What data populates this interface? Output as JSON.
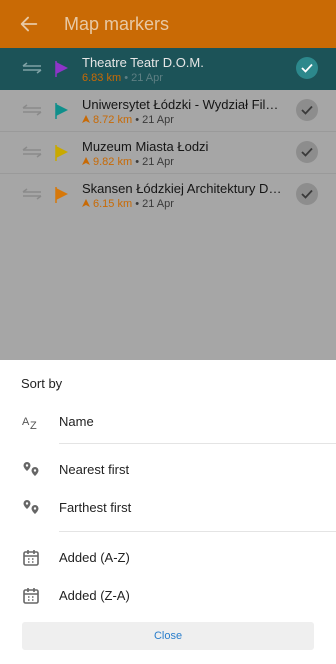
{
  "appbar": {
    "title": "Map markers",
    "back_icon": "arrow-left-icon"
  },
  "markers": [
    {
      "name": "Theatre Teatr D.O.M.",
      "distance": "6.83 km",
      "date": "21 Apr",
      "flag_color": "#8e34c9",
      "selected": true,
      "show_arrow": false
    },
    {
      "name": "Uniwersytet Łódzki - Wydział Filolo...",
      "distance": "8.72 km",
      "date": "21 Apr",
      "flag_color": "#0f8f8b",
      "selected": false,
      "show_arrow": true
    },
    {
      "name": "Muzeum Miasta Łodzi",
      "distance": "9.82 km",
      "date": "21 Apr",
      "flag_color": "#c9a900",
      "selected": false,
      "show_arrow": true
    },
    {
      "name": "Skansen Łódzkiej Architektury Dre...",
      "distance": "6.15 km",
      "date": "21 Apr",
      "flag_color": "#d7780a",
      "selected": false,
      "show_arrow": true
    }
  ],
  "sort_sheet": {
    "title": "Sort by",
    "options": [
      {
        "label": "Name",
        "icon": "sort-alphabetical-icon"
      },
      {
        "label": "Nearest first",
        "icon": "map-pins-icon"
      },
      {
        "label": "Farthest first",
        "icon": "map-pins-icon"
      },
      {
        "label": "Added (A-Z)",
        "icon": "calendar-icon"
      },
      {
        "label": "Added (Z-A)",
        "icon": "calendar-icon"
      }
    ],
    "close_label": "Close"
  },
  "colors": {
    "appbar": "#c96a05",
    "selected_row": "#1c5358",
    "accent_text": "#c86a05",
    "link": "#2a7ecb"
  }
}
